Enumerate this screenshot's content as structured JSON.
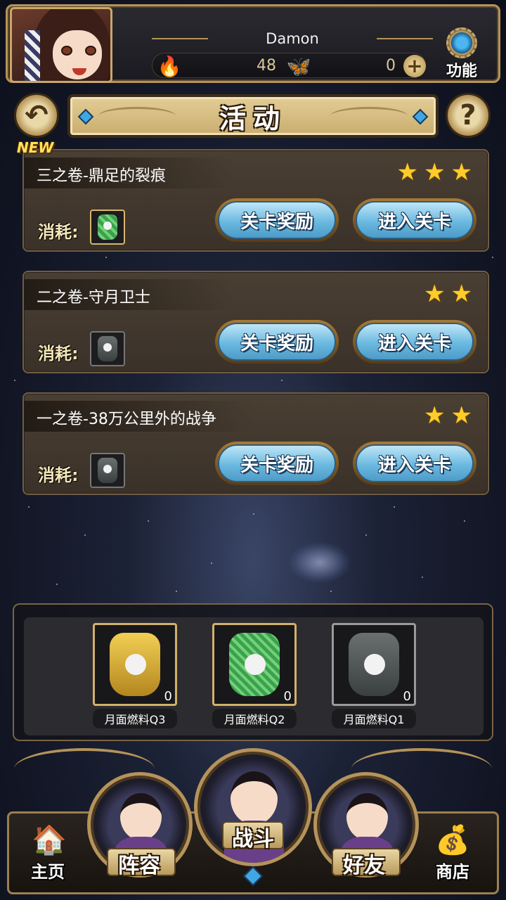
{
  "header": {
    "player_name": "Damon",
    "stamina_value": "48",
    "currency_value": "0",
    "function_label": "功能"
  },
  "title_bar": {
    "title": "活动"
  },
  "new_badge": "NEW",
  "stages": [
    {
      "name": "三之卷-鼎足的裂痕",
      "stars": 3,
      "cost_label": "消耗:",
      "cost_item": "green-fuel-jar-icon",
      "reward_label": "关卡奖励",
      "enter_label": "进入关卡"
    },
    {
      "name": "二之卷-守月卫士",
      "stars": 2,
      "cost_label": "消耗:",
      "cost_item": "gray-fuel-jar-icon",
      "reward_label": "关卡奖励",
      "enter_label": "进入关卡"
    },
    {
      "name": "一之卷-38万公里外的战争",
      "stars": 2,
      "cost_label": "消耗:",
      "cost_item": "gray-fuel-jar-icon",
      "reward_label": "关卡奖励",
      "enter_label": "进入关卡"
    }
  ],
  "inventory": [
    {
      "name": "月面燃料Q3",
      "count": "0",
      "color": "gold"
    },
    {
      "name": "月面燃料Q2",
      "count": "0",
      "color": "green"
    },
    {
      "name": "月面燃料Q1",
      "count": "0",
      "color": "gray"
    }
  ],
  "nav": {
    "home": "主页",
    "team": "阵容",
    "battle": "战斗",
    "friends": "好友",
    "shop": "商店"
  },
  "colors": {
    "gold_frame": "#b5935a",
    "button_blue": "#6ab9e0",
    "star_yellow": "#ffcc2a"
  }
}
